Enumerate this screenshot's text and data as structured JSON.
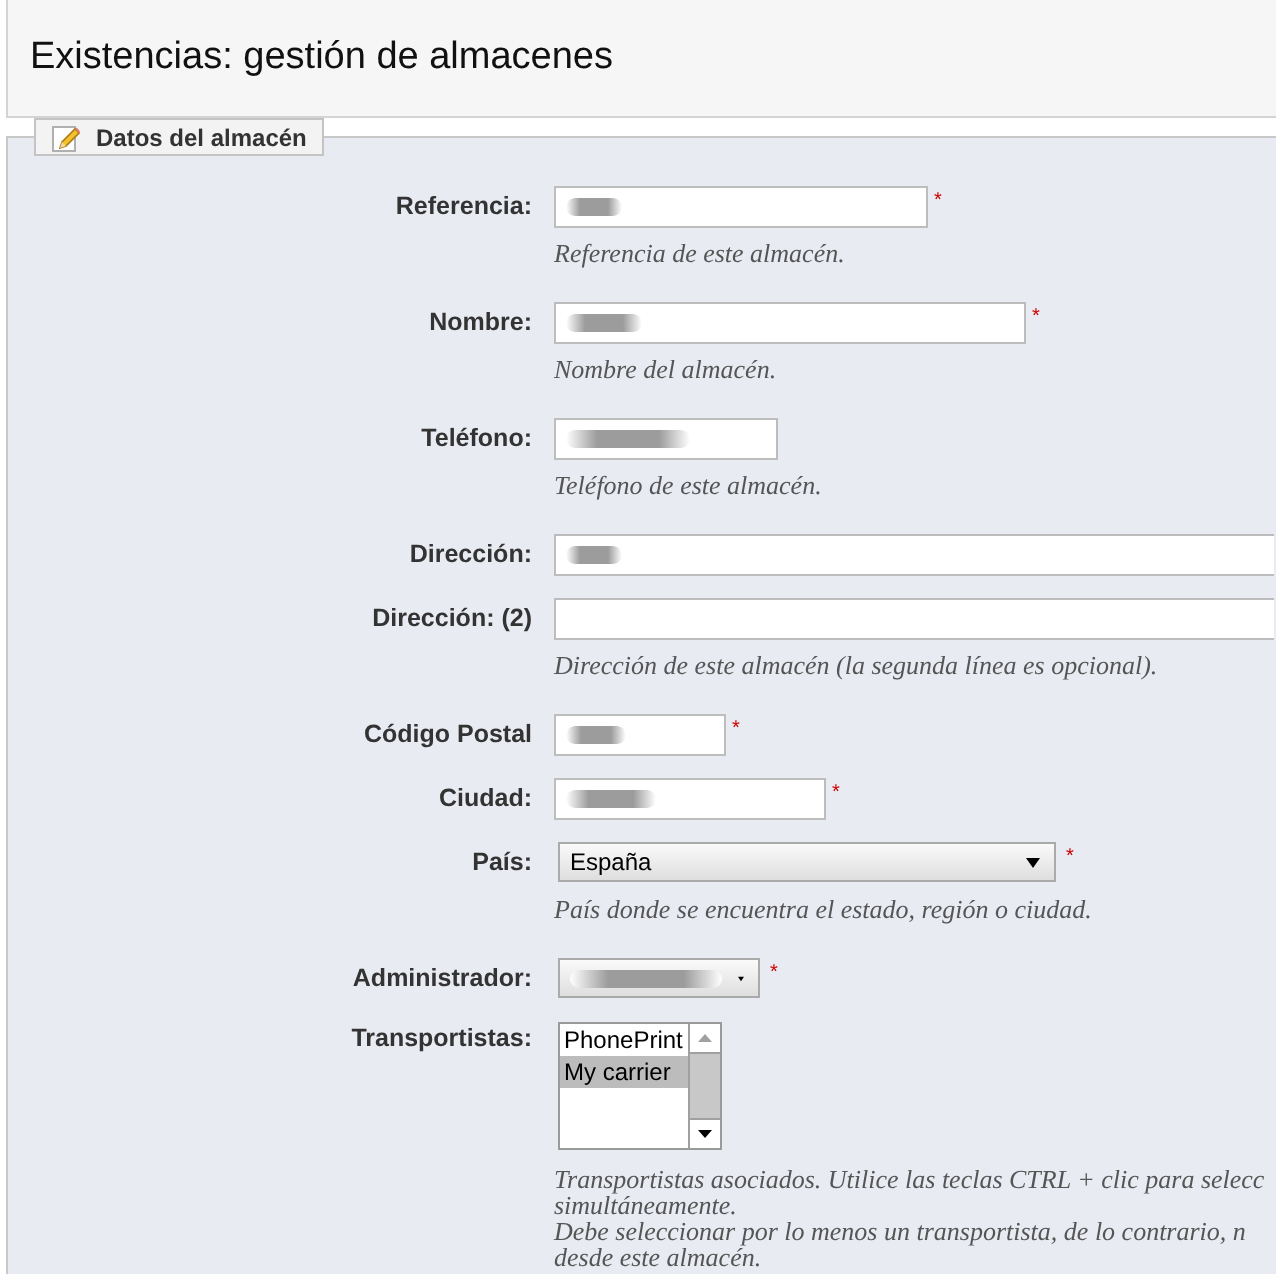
{
  "page_header": {
    "title": "Existencias: gestión de almacenes"
  },
  "section": {
    "legend": "Datos del almacén"
  },
  "fields": [
    {
      "kind": "text",
      "label": "Referencia:",
      "blurred": true,
      "required_mark": "*",
      "hint": "Referencia de este almacén."
    },
    {
      "kind": "text",
      "label": "Nombre:",
      "blurred": true,
      "required_mark": "*",
      "hint": "Nombre del almacén."
    },
    {
      "kind": "text",
      "label": "Teléfono:",
      "blurred": true,
      "hint": "Teléfono de este almacén."
    },
    {
      "kind": "text",
      "label": "Dirección:",
      "blurred": true
    },
    {
      "kind": "text",
      "label": "Dirección: (2)",
      "blurred": false,
      "hint": "Dirección de este almacén (la segunda línea es opcional)."
    },
    {
      "kind": "text",
      "label": "Código Postal",
      "blurred": true,
      "required_mark": "*"
    },
    {
      "kind": "text",
      "label": "Ciudad:",
      "blurred": true,
      "required_mark": "*"
    },
    {
      "kind": "select",
      "label": "País:",
      "value": "España",
      "blurred": false,
      "required_mark": "*",
      "hint": "País donde se encuentra el estado, región o ciudad."
    },
    {
      "kind": "select",
      "label": "Administrador:",
      "blurred": true,
      "required_mark": "*"
    },
    {
      "kind": "listbox",
      "label": "Transportistas:",
      "options": [
        {
          "label": "PhonePrint",
          "selected": false
        },
        {
          "label": "My carrier",
          "selected": true
        }
      ],
      "hint_lines": [
        "Transportistas asociados. Utilice las teclas CTRL + clic para selecc",
        "simultáneamente.",
        "Debe seleccionar por lo menos un transportista, de lo contrario, n",
        "desde este almacén."
      ]
    }
  ]
}
